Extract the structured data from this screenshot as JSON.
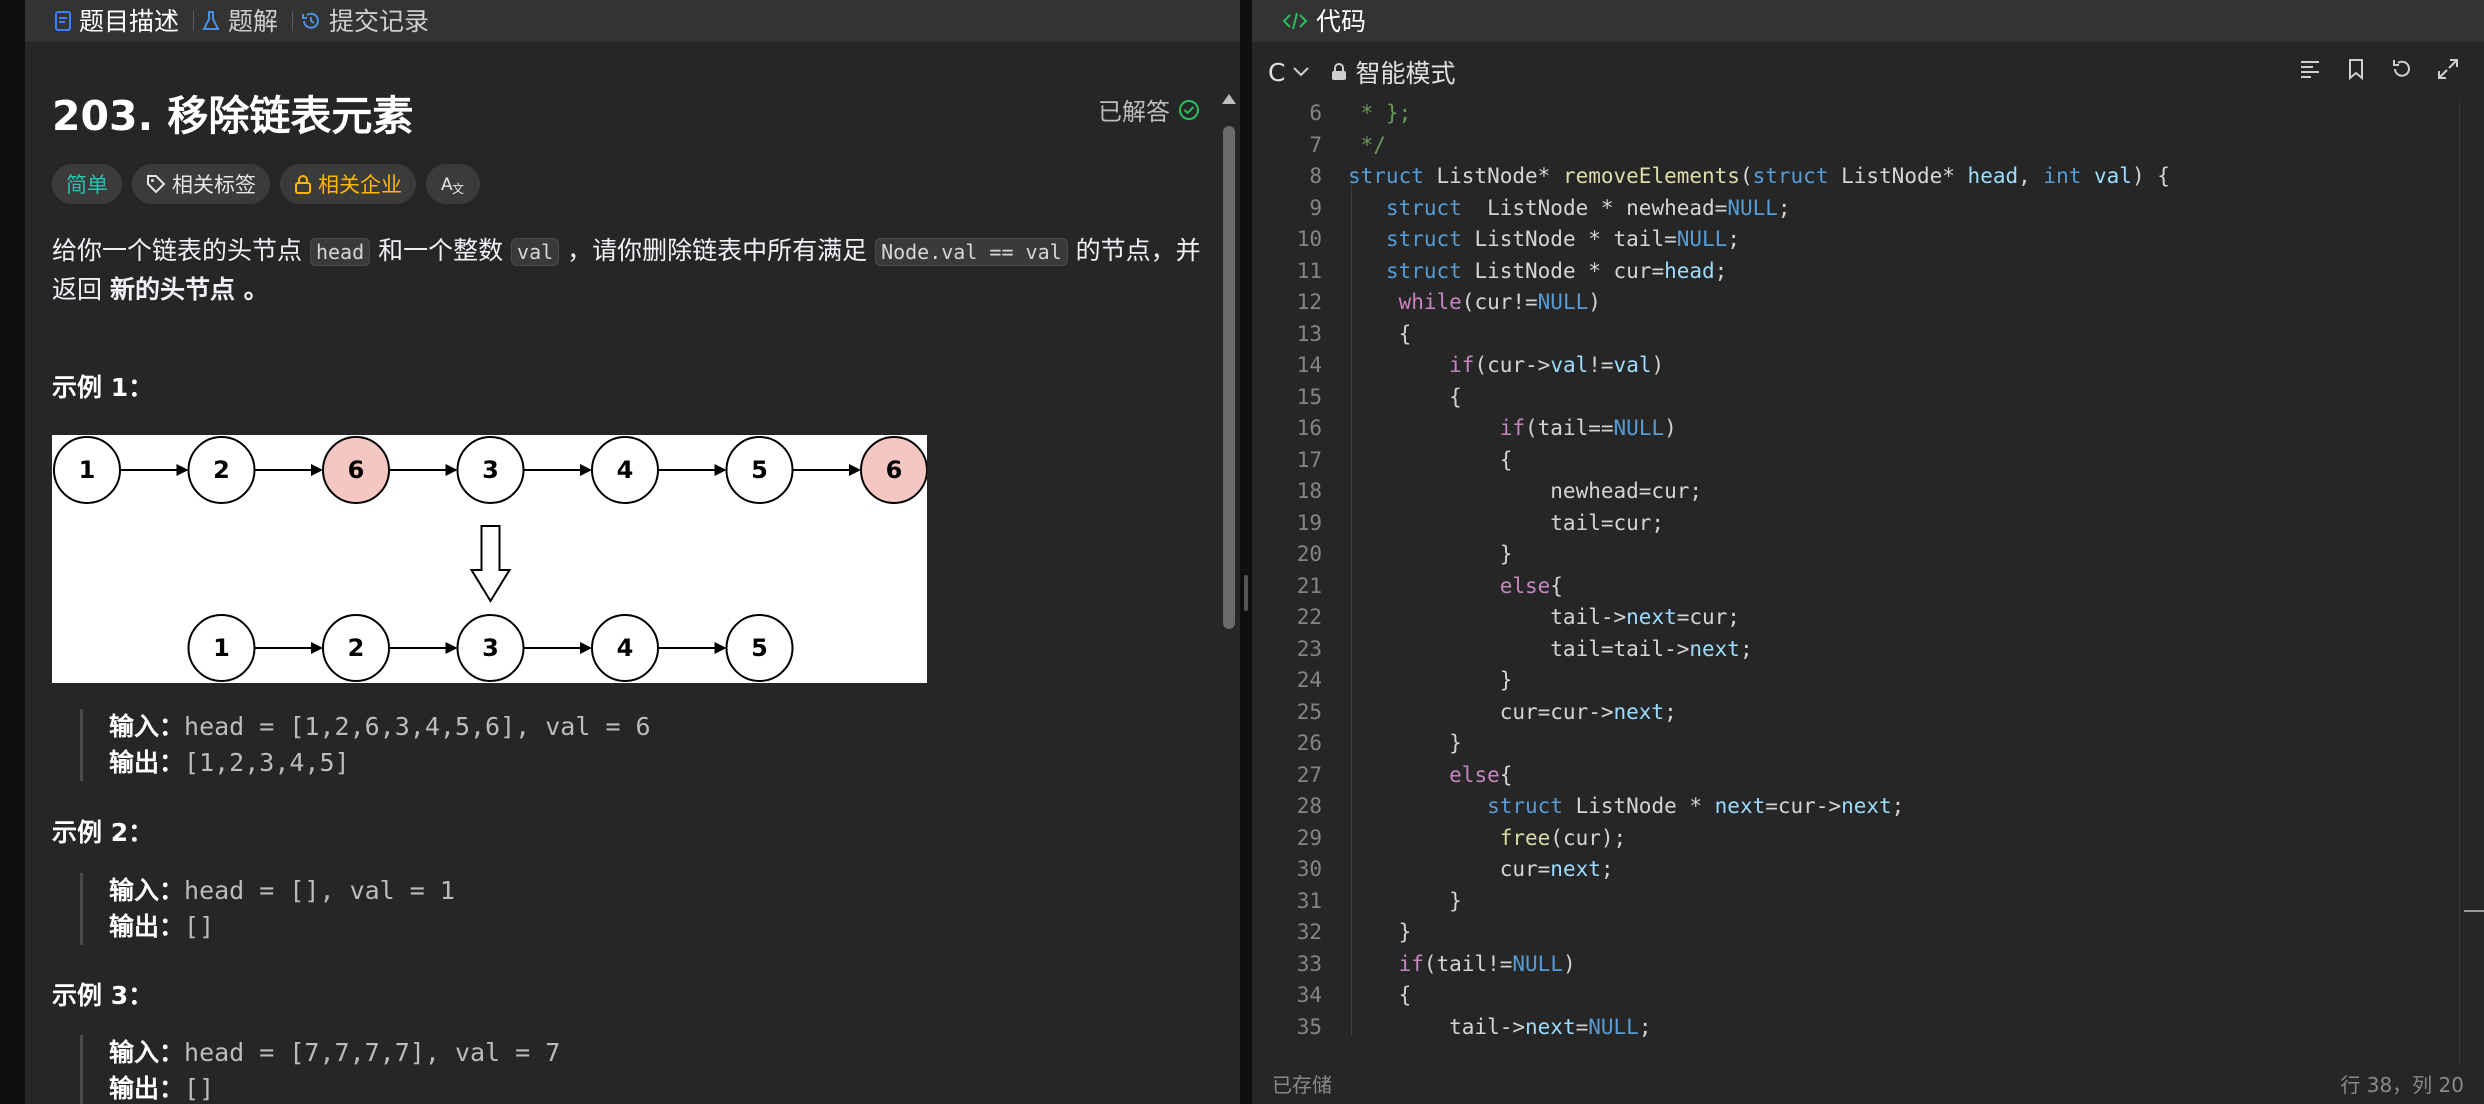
{
  "left_tabs": [
    {
      "label": "题目描述",
      "icon": "document-icon"
    },
    {
      "label": "题解",
      "icon": "flask-icon"
    },
    {
      "label": "提交记录",
      "icon": "history-icon"
    }
  ],
  "problem": {
    "title": "203. 移除链表元素",
    "status": "已解答",
    "tags": {
      "difficulty": "简单",
      "related_tags": "相关标签",
      "companies": "相关企业",
      "translate": "A文"
    },
    "desc_1": "给你一个链表的头节点 ",
    "desc_code_1": "head",
    "desc_2": " 和一个整数 ",
    "desc_code_2": "val",
    "desc_3": " ，请你删除链表中所有满足 ",
    "desc_code_3": "Node.val == val",
    "desc_4": " 的节点，并返回 ",
    "desc_bold": "新的头节点",
    "desc_5": " 。"
  },
  "diagram": {
    "top_row": [
      "1",
      "2",
      "6",
      "3",
      "4",
      "5",
      "6"
    ],
    "bottom_row": [
      "1",
      "2",
      "3",
      "4",
      "5"
    ],
    "highlight_color": "#f4c7c3"
  },
  "examples": [
    {
      "title": "示例 1：",
      "input_label": "输入：",
      "input": "head = [1,2,6,3,4,5,6], val = 6",
      "output_label": "输出：",
      "output": "[1,2,3,4,5]"
    },
    {
      "title": "示例 2：",
      "input_label": "输入：",
      "input": "head = [], val = 1",
      "output_label": "输出：",
      "output": "[]"
    },
    {
      "title": "示例 3：",
      "input_label": "输入：",
      "input": "head = [7,7,7,7], val = 7",
      "output_label": "输出：",
      "output": "[]"
    }
  ],
  "code_panel": {
    "tab_label": "代码",
    "language": "C",
    "mode": "智能模式",
    "status_left": "已存储",
    "status_right": "行 38，列 20"
  },
  "code_lines": [
    {
      "n": "6",
      "text": " * };"
    },
    {
      "n": "7",
      "text": " */"
    },
    {
      "n": "8",
      "text": "struct ListNode* removeElements(struct ListNode* head, int val) {"
    },
    {
      "n": "9",
      "text": "   struct  ListNode * newhead=NULL;"
    },
    {
      "n": "10",
      "text": "   struct ListNode * tail=NULL;"
    },
    {
      "n": "11",
      "text": "   struct ListNode * cur=head;"
    },
    {
      "n": "12",
      "text": "    while(cur!=NULL)"
    },
    {
      "n": "13",
      "text": "    {"
    },
    {
      "n": "14",
      "text": "        if(cur->val!=val)"
    },
    {
      "n": "15",
      "text": "        {"
    },
    {
      "n": "16",
      "text": "            if(tail==NULL)"
    },
    {
      "n": "17",
      "text": "            {"
    },
    {
      "n": "18",
      "text": "                newhead=cur;"
    },
    {
      "n": "19",
      "text": "                tail=cur;"
    },
    {
      "n": "20",
      "text": "            }"
    },
    {
      "n": "21",
      "text": "            else{"
    },
    {
      "n": "22",
      "text": "                tail->next=cur;"
    },
    {
      "n": "23",
      "text": "                tail=tail->next;"
    },
    {
      "n": "24",
      "text": "            }"
    },
    {
      "n": "25",
      "text": "            cur=cur->next;"
    },
    {
      "n": "26",
      "text": "        }"
    },
    {
      "n": "27",
      "text": "        else{"
    },
    {
      "n": "28",
      "text": "           struct ListNode * next=cur->next;"
    },
    {
      "n": "29",
      "text": "            free(cur);"
    },
    {
      "n": "30",
      "text": "            cur=next;"
    },
    {
      "n": "31",
      "text": "        }"
    },
    {
      "n": "32",
      "text": "    }"
    },
    {
      "n": "33",
      "text": "    if(tail!=NULL)"
    },
    {
      "n": "34",
      "text": "    {"
    },
    {
      "n": "35",
      "text": "        tail->next=NULL;"
    }
  ]
}
